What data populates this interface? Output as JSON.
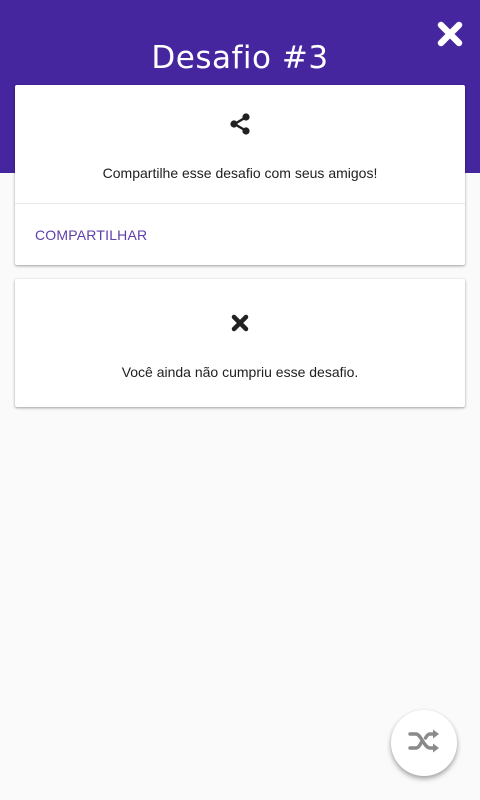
{
  "header": {
    "title": "Desafio #3",
    "close_icon": "close-icon",
    "background_color": "#45269f"
  },
  "share_card": {
    "icon": "share-icon",
    "text": "Compartilhe esse desafio com seus amigos!",
    "action_label": "COMPARTILHAR",
    "action_color": "#5e3ea8"
  },
  "status_card": {
    "icon": "close-icon",
    "text": "Você ainda não cumpriu esse desafio."
  },
  "fab": {
    "icon": "shuffle-icon"
  }
}
